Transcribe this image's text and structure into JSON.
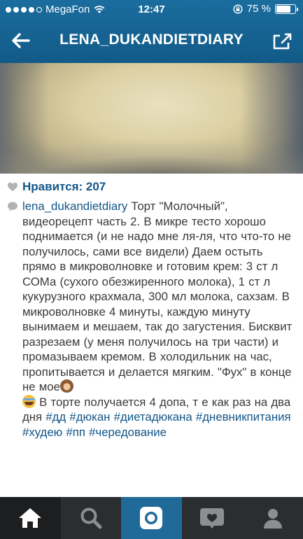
{
  "status_bar": {
    "carrier": "MegaFon",
    "time": "12:47",
    "battery_percent_text": "75 %",
    "battery_level": 0.75
  },
  "navbar": {
    "title": "LENA_DUKANDIETDIARY",
    "back_icon": "back-arrow-icon",
    "share_icon": "share-icon"
  },
  "post": {
    "likes_text": "Нравится: 207",
    "caption_user": "lena_dukandietdiary",
    "caption_text_1": " Торт \"Молочный\", видеорецепт часть 2. В микре тесто хорошо поднимается (и не надо мне ля-ля, что что-то не получилось, сами все видели) Даем остыть прямо в микроволновке и готовим крем: 3 ст л СОМа (сухого обезжиренного молока), 1 ст л кукурузного крахмала, 300 мл молока, сахзам. В микроволновке 4 минуты, каждую минуту вынимаем и мешаем, так до загустения. Бисквит разрезаем (у меня получилось на три части) и промазываем кремом. В холодильник на час, пропитывается и делается мягким. \"Фух\" в конце не мое",
    "caption_text_2": " В торте получается 4 допа, т е как раз на два дня ",
    "hashtags": [
      "#дд",
      "#дюкан",
      "#диетадюкана",
      "#дневникпитания",
      "#худею",
      "#пп",
      "#чередование"
    ]
  },
  "tabbar": {
    "tabs": [
      "home-icon",
      "search-icon",
      "camera-icon",
      "activity-heart-icon",
      "profile-icon"
    ],
    "active_index": 0
  },
  "colors": {
    "header": "#135f8f",
    "link": "#125688",
    "text": "#3a3a3a",
    "tabbar": "#2b2e31",
    "camera_tab": "#1f6a98"
  }
}
